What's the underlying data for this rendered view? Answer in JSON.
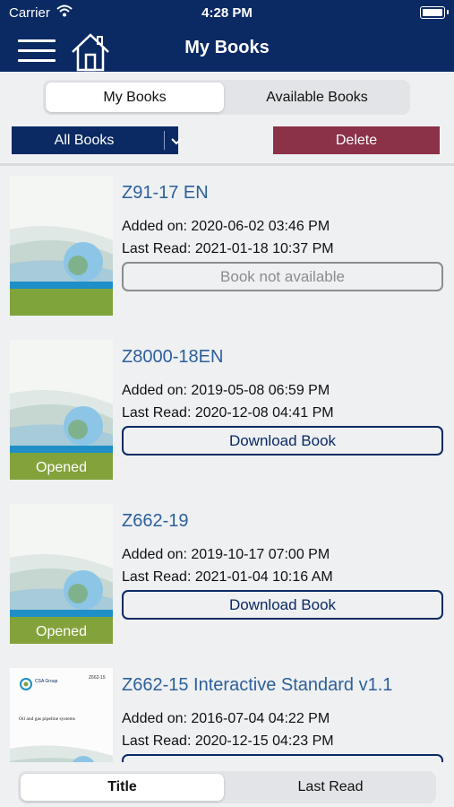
{
  "status_bar": {
    "carrier": "Carrier",
    "time": "4:28 PM"
  },
  "nav": {
    "title": "My Books"
  },
  "tabs_top": [
    {
      "label": "My Books",
      "active": true
    },
    {
      "label": "Available Books",
      "active": false
    }
  ],
  "filter": {
    "selected": "All Books"
  },
  "delete_label": "Delete",
  "books": [
    {
      "title": "Z91-17 EN",
      "added": "Added on: 2020-06-02 03:46 PM",
      "last_read": "Last Read: 2021-01-18 10:37 PM",
      "badge": "",
      "action": "Book not available",
      "action_enabled": false
    },
    {
      "title": "Z8000-18EN",
      "added": "Added on: 2019-05-08 06:59 PM",
      "last_read": "Last Read: 2020-12-08 04:41 PM",
      "badge": "Opened",
      "action": "Download Book",
      "action_enabled": true
    },
    {
      "title": "Z662-19",
      "added": "Added on: 2019-10-17 07:00 PM",
      "last_read": "Last Read: 2021-01-04 10:16 AM",
      "badge": "Opened",
      "action": "Download Book",
      "action_enabled": true
    },
    {
      "title": "Z662-15 Interactive Standard v1.1",
      "added": "Added on: 2016-07-04 04:22 PM",
      "last_read": "Last Read: 2020-12-15 04:23 PM",
      "badge": "",
      "action": "",
      "action_enabled": true
    }
  ],
  "cover_text": {
    "logo": "CSA Group",
    "doc_code": "Z662-15",
    "subtitle": "Oil and gas pipeline systems"
  },
  "tabs_bottom": [
    {
      "label": "Title",
      "active": true
    },
    {
      "label": "Last Read",
      "active": false
    }
  ],
  "colors": {
    "navy": "#0b2a63",
    "link": "#2d5f9a",
    "delete": "#8b3148",
    "opened": "#84a23c"
  }
}
